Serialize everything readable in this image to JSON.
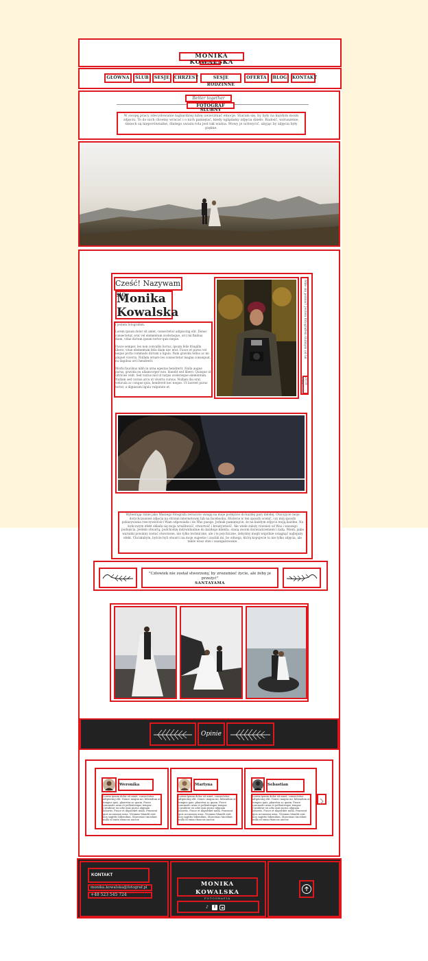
{
  "header": {
    "brand": "MONIKA KOWALSKA",
    "subtitle": "FOTOGRAFIA"
  },
  "nav": [
    "GŁÓWNA",
    "ŚLUB",
    "SESJE",
    "CHRZEST",
    "SESJE RODZINNE",
    "OFERTA",
    "BLOG",
    "KONTAKT"
  ],
  "intro": {
    "script": "Better together",
    "heading": "FOTOGRAF ŚLUBNY",
    "text": "W swojej pracy zdecydowanie najbardziej lubię uwieczniać emocje. Staram się, by były na każdym moim zdjęciu. To do nich chcemy wracać i o nich pamiętać, kiedy oglądamy zdjęcia dzieło. Radość, wzruszenie, śmiech są nieporównalne, dlatego uważa rola jest tak ważna. Mowy je uchwycić, abyjąc by zdjęcia były piękne."
  },
  "about": {
    "greeting": "Cześć! Nazywam się",
    "name_line1": "Monika",
    "name_line2": "Kowalska",
    "role": "I jestem fotografem.",
    "p1": "Lorem ipsum dolor sit amet, consectetur adipiscing elit. Donec consectetur, erat vel elementum scelerisque, orci mi finibus diam, vitae dictum ipsum tortor quis neque.",
    "p2": "Fusce semper, leo non convallis luctus, ipsum felis fringilla libero, vitae elementum felis diam nec erat. Fusce et purus vel neque porta commodo dictum a ligula. Nam gravida tellus ac mi aliquet viverra. Nullam ornare leo consectetur magna consequat, eu dapibus orci hendrerit.",
    "p3": "Morbi faucibus nibh in urna egestas hendrerit. Nulla augue purus, gravida eu ullamcorper non, blandit sed libero. Quisque ut ultricies velit. Sed varius nisl ut turpis scelerisque elementum. Nullam sed cursus arcu ut viverra cursus. Nullam dui erat, vehicula ac congue quis, hendrerit nec neque. Ut laoreet purus tortor, a dignissim ligula vulputate et.",
    "vertical": "Miłe się poznać! Jestem fotografem ślubnym od lat",
    "vertical_year": "2010 roku",
    "bottom_text": "Wybierając mnie jako Waszego fotografa zwracicie uwagę na moje podejście do każdej pary młodej. Otaczyjcie moje dotychczasowe zdjęcia na stronie internetowej lub na facebooku. Możecie w ten sposób ocenić, czy mój sposób pokazywania rzeczywistości Wam odpowiada i do Was pasuje. Jednak pamiętajcie, że na każdym zdjęciu moją każdne. Na końcowym efekt składa się moja wrażliwość, otwartość i kreatywność. Ale wiele zależy również od Was i waszego podejścia. Jestem otwartą, podchodzę indywidualnie do każdego klienta, staną swoim doświadczeniem i radą. Wiem, jakie warunki powinny zostać stworzone, nie tylko techniczne, ale i te psychiczne, żebyśmy mogli wspólnie osiągnąć najlepszy efekt. Chciałabym, byście byli otwarci na moje sugestie i zaufali mi, bo odnoga, którą kopujecie to nie tylko zdjęcia, ale także wasz stan i zaangażowanie."
  },
  "quote": {
    "text": "\"Człowiek nie został stworzony, by zrozumieć życie, ale żeby je przeżyć\"",
    "author": "SANTAYAMA"
  },
  "reviews": {
    "title": "Opinie",
    "items": [
      {
        "name": "Weronika",
        "text": "Lorem ipsum dolor sit amet, consectetur adipiscing elit. Donec magna mi, bibendum at tempus quis, pharetra ac quam. Fusce commodo urna et pellentesque tempor. Curabitur ex odio quis purus aliquam lobortis. Fusce et imperdiet nulla. Praesent quis accumsan urna. Vivamus blandit erat non sagittis bibendum. Maecenas tincidunt nulla id enim rhoncus auctor."
      },
      {
        "name": "Martyna",
        "text": "Lorem ipsum dolor sit amet, consectetur adipiscing elit. Donec magna mi, bibendum at tempus quis, pharetra ac quam. Fusce commodo urna et pellentesque tempor. Curabitur ex odio quis purus aliquam lobortis. Fusce et imperdiet nulla. Praesent quis accumsan urna. Vivamus blandit erat non sagittis bibendum. Maecenas tincidunt nulla id enim rhoncus auctor."
      },
      {
        "name": "Sebastian",
        "text": "Lorem ipsum dolor sit amet, consectetur adipiscing elit. Donec magna mi, bibendum at tempus quis, pharetra ac quam. Fusce commodo urna et pellentesque tempor. Curabitur ex odio quis purus aliquam lobortis. Fusce et imperdiet nulla. Praesent quis accumsan urna. Vivamus blandit erat non sagittis bibendum. Maecenas tincidunt nulla id enim rhoncus auctor."
      }
    ]
  },
  "footer": {
    "contact_title": "KONTAKT",
    "email": "monika.kowalska@fotograf.pl",
    "phone": "+48 523 545 724",
    "brand": "MONIKA KOWALSKA",
    "subtitle": "FOTOGRAFIA",
    "icons": [
      "tiktok-icon",
      "facebook-icon",
      "instagram-icon"
    ]
  },
  "colors": {
    "accent": "#e0161d",
    "dark": "#222222",
    "cream": "#fff5db"
  }
}
